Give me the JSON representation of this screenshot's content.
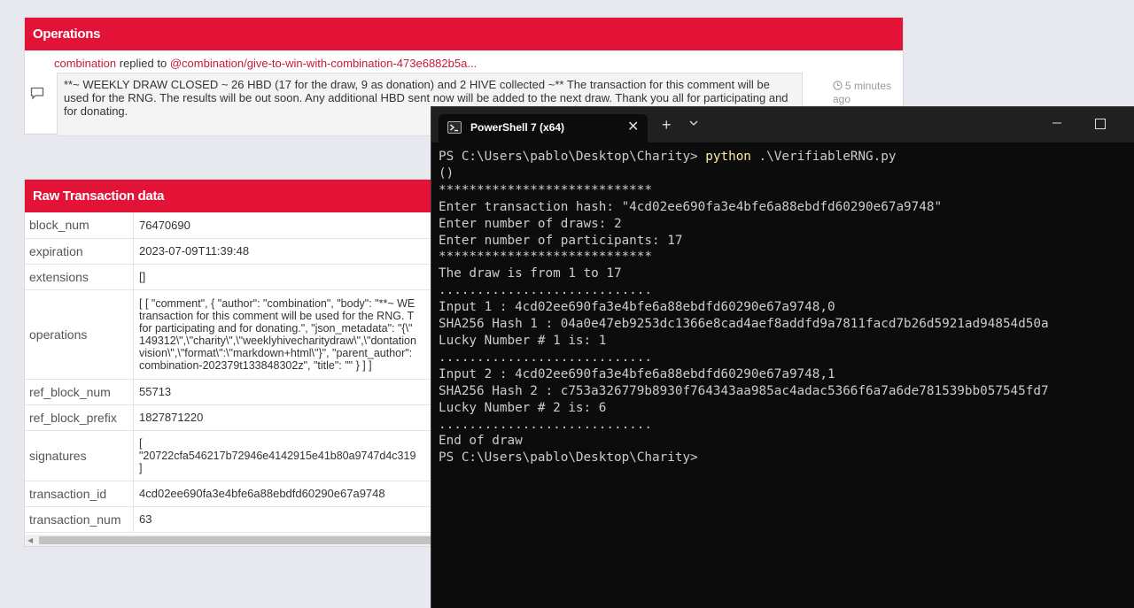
{
  "operations": {
    "title": "Operations",
    "author": "combination",
    "action": "replied to",
    "target": "@combination/give-to-win-with-combination-473e6882b5a...",
    "body": "**~ WEEKLY DRAW CLOSED ~ 26 HBD (17 for the draw, 9 as donation) and 2 HIVE collected ~** The transaction for this comment will be used for the RNG. The results will be out soon. Any additional HBD sent now will be added to the next draw. Thank you all for participating and for donating.",
    "time_1": "5 minutes",
    "time_2": "ago"
  },
  "raw": {
    "title": "Raw Transaction data",
    "rows": [
      {
        "key": "block_num",
        "value": "76470690"
      },
      {
        "key": "expiration",
        "value": "2023-07-09T11:39:48"
      },
      {
        "key": "extensions",
        "value": "[]"
      },
      {
        "key": "operations",
        "lines": [
          "[ [ \"comment\", { \"author\": \"combination\", \"body\": \"**~ WE",
          "transaction for this comment will be used for the RNG. T",
          "for participating and for donating.\", \"json_metadata\": \"{\\\"",
          "149312\\\",\\\"charity\\\",\\\"weeklyhivecharitydraw\\\",\\\"dontation",
          "vision\\\",\\\"format\\\":\\\"markdown+html\\\"}\", \"parent_author\":",
          "combination-202379t133848302z\", \"title\": \"\" } ] ]"
        ]
      },
      {
        "key": "ref_block_num",
        "value": "55713"
      },
      {
        "key": "ref_block_prefix",
        "value": "1827871220"
      },
      {
        "key": "signatures",
        "lines": [
          "[",
          "\"20722cfa546217b72946e4142915e41b80a9747d4c319",
          "]"
        ]
      },
      {
        "key": "transaction_id",
        "value": "4cd02ee690fa3e4bfe6a88ebdfd60290e67a9748"
      },
      {
        "key": "transaction_num",
        "value": "63"
      }
    ]
  },
  "terminal": {
    "tab_title": "PowerShell 7 (x64)",
    "prompt": "PS C:\\Users\\pablo\\Desktop\\Charity> ",
    "command": "python",
    "command_arg": " .\\VerifiableRNG.py",
    "lines": [
      "()",
      "****************************",
      "Enter transaction hash: \"4cd02ee690fa3e4bfe6a88ebdfd60290e67a9748\"",
      "Enter number of draws: 2",
      "Enter number of participants: 17",
      "****************************",
      "The draw is from 1 to 17",
      "............................",
      "Input 1 : 4cd02ee690fa3e4bfe6a88ebdfd60290e67a9748,0",
      "SHA256 Hash 1 : 04a0e47eb9253dc1366e8cad4aef8addfd9a7811facd7b26d5921ad94854d50a",
      "Lucky Number # 1 is: 1",
      "............................",
      "Input 2 : 4cd02ee690fa3e4bfe6a88ebdfd60290e67a9748,1",
      "SHA256 Hash 2 : c753a326779b8930f764343aa985ac4adac5366f6a7a6de781539bb057545fd7",
      "Lucky Number # 2 is: 6",
      "............................",
      "End of draw",
      "PS C:\\Users\\pablo\\Desktop\\Charity>"
    ]
  }
}
